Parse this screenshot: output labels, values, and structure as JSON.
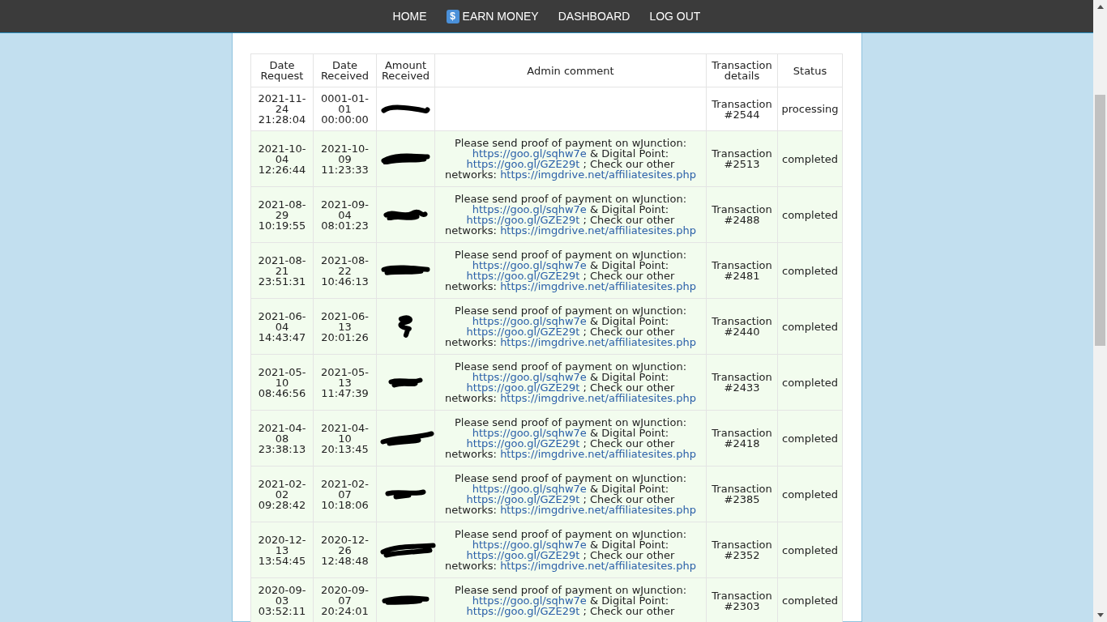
{
  "nav": {
    "items": [
      {
        "label": "HOME"
      },
      {
        "label": "EARN MONEY",
        "badge": "$"
      },
      {
        "label": "DASHBOARD"
      },
      {
        "label": "LOG OUT"
      }
    ]
  },
  "table": {
    "columns": [
      "Date Request",
      "Date Received",
      "Amount Received",
      "Admin comment",
      "Transaction details",
      "Status"
    ],
    "rows": [
      {
        "date_request": "2021-11-24 21:28:04",
        "date_received": "0001-01-01 00:00:00",
        "amount_redacted": true,
        "comment": [],
        "transaction": "Transaction #2544",
        "status": "processing"
      },
      {
        "date_request": "2021-10-04 12:26:44",
        "date_received": "2021-10-09 11:23:33",
        "amount_redacted": true,
        "comment": [
          {
            "kind": "text",
            "text": "Please send proof of payment on wJunction: "
          },
          {
            "kind": "link",
            "text": "https://goo.gl/sqhw7e"
          },
          {
            "kind": "text",
            "text": " & Digital Point: "
          },
          {
            "kind": "link",
            "text": "https://goo.gl/GZE29t"
          },
          {
            "kind": "text",
            "text": " ; Check our other networks: "
          },
          {
            "kind": "link",
            "text": "https://imgdrive.net/affiliatesites.php"
          }
        ],
        "transaction": "Transaction #2513",
        "status": "completed"
      },
      {
        "date_request": "2021-08-29 10:19:55",
        "date_received": "2021-09-04 08:01:23",
        "amount_redacted": true,
        "comment": [
          {
            "kind": "text",
            "text": "Please send proof of payment on wJunction: "
          },
          {
            "kind": "link",
            "text": "https://goo.gl/sqhw7e"
          },
          {
            "kind": "text",
            "text": " & Digital Point: "
          },
          {
            "kind": "link",
            "text": "https://goo.gl/GZE29t"
          },
          {
            "kind": "text",
            "text": " ; Check our other networks: "
          },
          {
            "kind": "link",
            "text": "https://imgdrive.net/affiliatesites.php"
          }
        ],
        "transaction": "Transaction #2488",
        "status": "completed"
      },
      {
        "date_request": "2021-08-21 23:51:31",
        "date_received": "2021-08-22 10:46:13",
        "amount_redacted": true,
        "comment": [
          {
            "kind": "text",
            "text": "Please send proof of payment on wJunction: "
          },
          {
            "kind": "link",
            "text": "https://goo.gl/sqhw7e"
          },
          {
            "kind": "text",
            "text": " & Digital Point: "
          },
          {
            "kind": "link",
            "text": "https://goo.gl/GZE29t"
          },
          {
            "kind": "text",
            "text": " ; Check our other networks: "
          },
          {
            "kind": "link",
            "text": "https://imgdrive.net/affiliatesites.php"
          }
        ],
        "transaction": "Transaction #2481",
        "status": "completed"
      },
      {
        "date_request": "2021-06-04 14:43:47",
        "date_received": "2021-06-13 20:01:26",
        "amount_redacted": true,
        "comment": [
          {
            "kind": "text",
            "text": "Please send proof of payment on wJunction: "
          },
          {
            "kind": "link",
            "text": "https://goo.gl/sqhw7e"
          },
          {
            "kind": "text",
            "text": " & Digital Point: "
          },
          {
            "kind": "link",
            "text": "https://goo.gl/GZE29t"
          },
          {
            "kind": "text",
            "text": " ; Check our other networks: "
          },
          {
            "kind": "link",
            "text": "https://imgdrive.net/affiliatesites.php"
          }
        ],
        "transaction": "Transaction #2440",
        "status": "completed"
      },
      {
        "date_request": "2021-05-10 08:46:56",
        "date_received": "2021-05-13 11:47:39",
        "amount_redacted": true,
        "comment": [
          {
            "kind": "text",
            "text": "Please send proof of payment on wJunction: "
          },
          {
            "kind": "link",
            "text": "https://goo.gl/sqhw7e"
          },
          {
            "kind": "text",
            "text": " & Digital Point: "
          },
          {
            "kind": "link",
            "text": "https://goo.gl/GZE29t"
          },
          {
            "kind": "text",
            "text": " ; Check our other networks: "
          },
          {
            "kind": "link",
            "text": "https://imgdrive.net/affiliatesites.php"
          }
        ],
        "transaction": "Transaction #2433",
        "status": "completed"
      },
      {
        "date_request": "2021-04-08 23:38:13",
        "date_received": "2021-04-10 20:13:45",
        "amount_redacted": true,
        "comment": [
          {
            "kind": "text",
            "text": "Please send proof of payment on wJunction: "
          },
          {
            "kind": "link",
            "text": "https://goo.gl/sqhw7e"
          },
          {
            "kind": "text",
            "text": " & Digital Point: "
          },
          {
            "kind": "link",
            "text": "https://goo.gl/GZE29t"
          },
          {
            "kind": "text",
            "text": " ; Check our other networks: "
          },
          {
            "kind": "link",
            "text": "https://imgdrive.net/affiliatesites.php"
          }
        ],
        "transaction": "Transaction #2418",
        "status": "completed"
      },
      {
        "date_request": "2021-02-02 09:28:42",
        "date_received": "2021-02-07 10:18:06",
        "amount_redacted": true,
        "comment": [
          {
            "kind": "text",
            "text": "Please send proof of payment on wJunction: "
          },
          {
            "kind": "link",
            "text": "https://goo.gl/sqhw7e"
          },
          {
            "kind": "text",
            "text": " & Digital Point: "
          },
          {
            "kind": "link",
            "text": "https://goo.gl/GZE29t"
          },
          {
            "kind": "text",
            "text": " ; Check our other networks: "
          },
          {
            "kind": "link",
            "text": "https://imgdrive.net/affiliatesites.php"
          }
        ],
        "transaction": "Transaction #2385",
        "status": "completed"
      },
      {
        "date_request": "2020-12-13 13:54:45",
        "date_received": "2020-12-26 12:48:48",
        "amount_redacted": true,
        "comment": [
          {
            "kind": "text",
            "text": "Please send proof of payment on wJunction: "
          },
          {
            "kind": "link",
            "text": "https://goo.gl/sqhw7e"
          },
          {
            "kind": "text",
            "text": " & Digital Point: "
          },
          {
            "kind": "link",
            "text": "https://goo.gl/GZE29t"
          },
          {
            "kind": "text",
            "text": " ; Check our other networks: "
          },
          {
            "kind": "link",
            "text": "https://imgdrive.net/affiliatesites.php"
          }
        ],
        "transaction": "Transaction #2352",
        "status": "completed"
      },
      {
        "date_request": "2020-09-03 03:52:11",
        "date_received": "2020-09-07 20:24:01",
        "amount_redacted": true,
        "comment": [
          {
            "kind": "text",
            "text": "Please send proof of payment on wJunction: "
          },
          {
            "kind": "link",
            "text": "https://goo.gl/sqhw7e"
          },
          {
            "kind": "text",
            "text": " & Digital Point: "
          },
          {
            "kind": "link",
            "text": "https://goo.gl/GZE29t"
          },
          {
            "kind": "text",
            "text": " ; Check our other"
          }
        ],
        "transaction": "Transaction #2303",
        "status": "completed"
      }
    ]
  }
}
